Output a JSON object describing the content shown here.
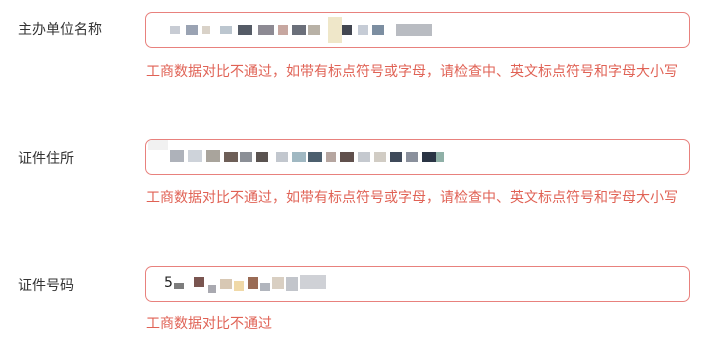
{
  "form": {
    "fields": [
      {
        "label": "主办单位名称",
        "error": "工商数据对比不通过，如带有标点符号或字母，请检查中、英文标点符号和字母大小写"
      },
      {
        "label": "证件住所",
        "error": "工商数据对比不通过，如带有标点符号或字母，请检查中、英文标点符号和字母大小写"
      },
      {
        "label": "证件号码",
        "value_visible_prefix": "5",
        "error": "工商数据对比不通过"
      }
    ]
  },
  "colors": {
    "error": "#e06255",
    "input_border_error": "#e8817d",
    "label": "#333333"
  }
}
